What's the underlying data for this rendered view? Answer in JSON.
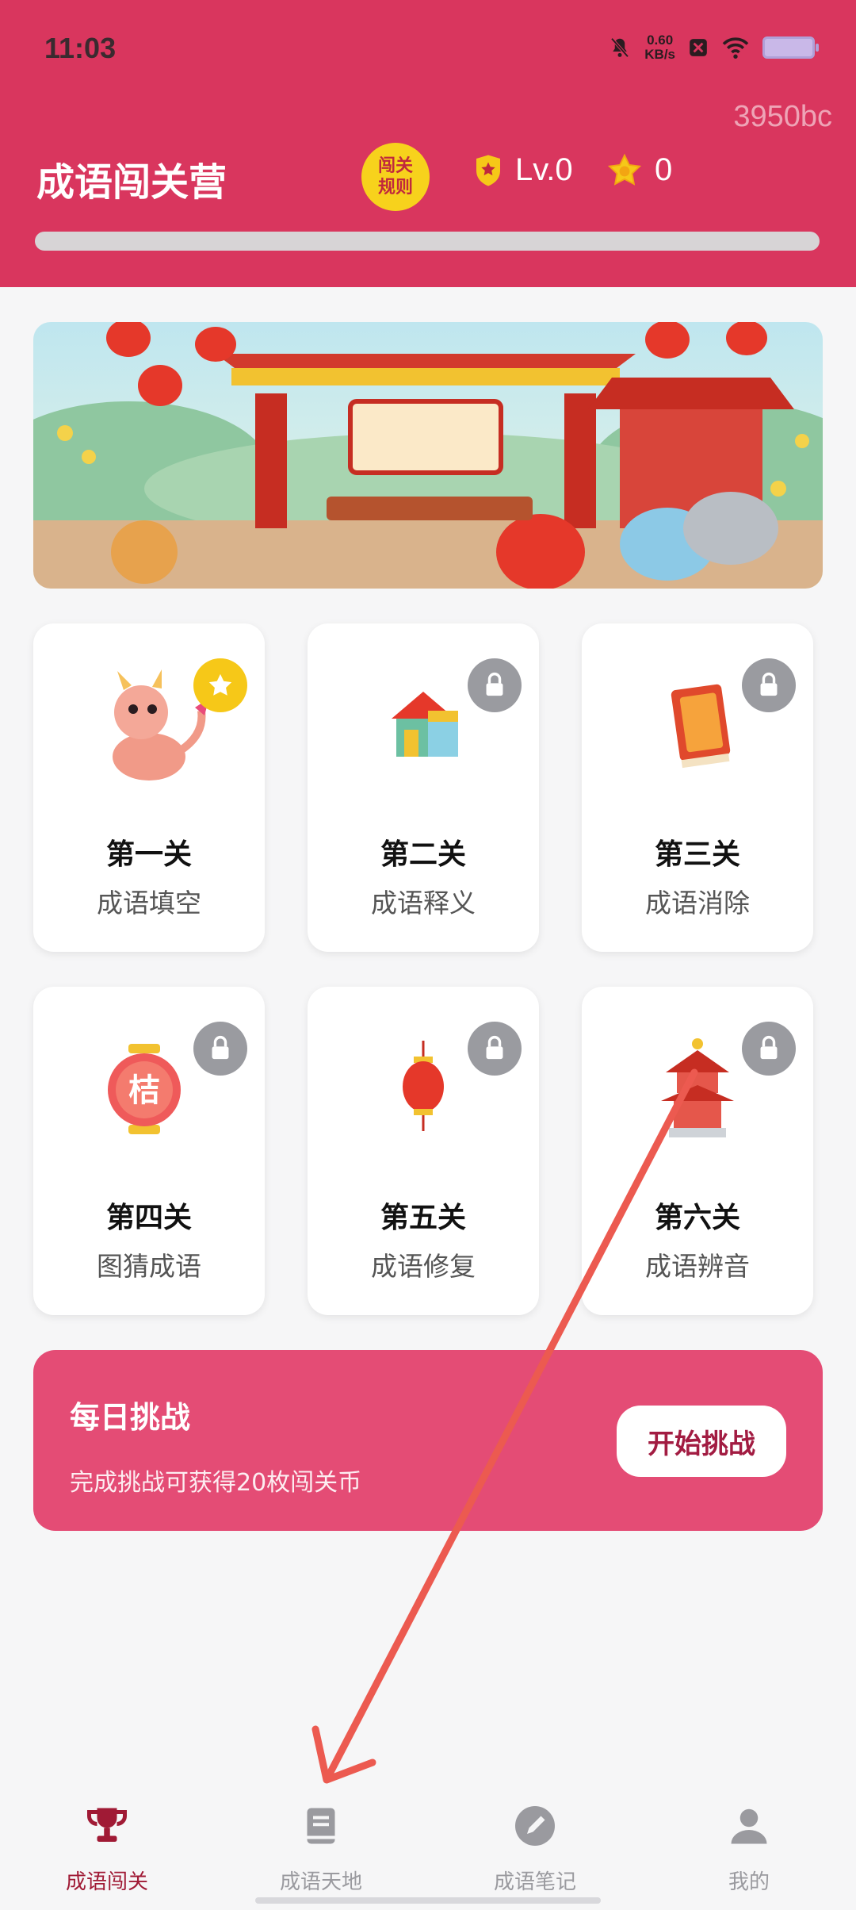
{
  "status_bar": {
    "time": "11:03",
    "net_speed_value": "0.60",
    "net_speed_unit": "KB/s"
  },
  "watermark": "3950bc",
  "header": {
    "title": "成语闯关营",
    "rules_badge_line1": "闯关",
    "rules_badge_line2": "规则",
    "level": "Lv.0",
    "coins": "0",
    "level_progress_fraction": 0
  },
  "levels": [
    {
      "title": "第一关",
      "subtitle": "成语填空",
      "state": "unlocked",
      "icon": "dragon-icon"
    },
    {
      "title": "第二关",
      "subtitle": "成语释义",
      "state": "locked",
      "icon": "house-block-icon"
    },
    {
      "title": "第三关",
      "subtitle": "成语消除",
      "state": "locked",
      "icon": "book-icon"
    },
    {
      "title": "第四关",
      "subtitle": "图猜成语",
      "state": "locked",
      "icon": "scroll-icon"
    },
    {
      "title": "第五关",
      "subtitle": "成语修复",
      "state": "locked",
      "icon": "lantern-icon"
    },
    {
      "title": "第六关",
      "subtitle": "成语辨音",
      "state": "locked",
      "icon": "pagoda-icon"
    }
  ],
  "daily_challenge": {
    "title": "每日挑战",
    "description": "完成挑战可获得20枚闯关币",
    "button_label": "开始挑战"
  },
  "tabbar": {
    "tabs": [
      {
        "label": "成语闯关",
        "icon": "trophy-icon",
        "active": true
      },
      {
        "label": "成语天地",
        "icon": "book-icon",
        "active": false
      },
      {
        "label": "成语笔记",
        "icon": "pencil-icon",
        "active": false
      },
      {
        "label": "我的",
        "icon": "person-icon",
        "active": false
      }
    ]
  },
  "colors": {
    "header": "#d9365e",
    "daily_card": "#e44c75",
    "active_tab": "#a01a35",
    "star_badge": "#f6c818",
    "lock_badge": "#9a9ba0"
  }
}
